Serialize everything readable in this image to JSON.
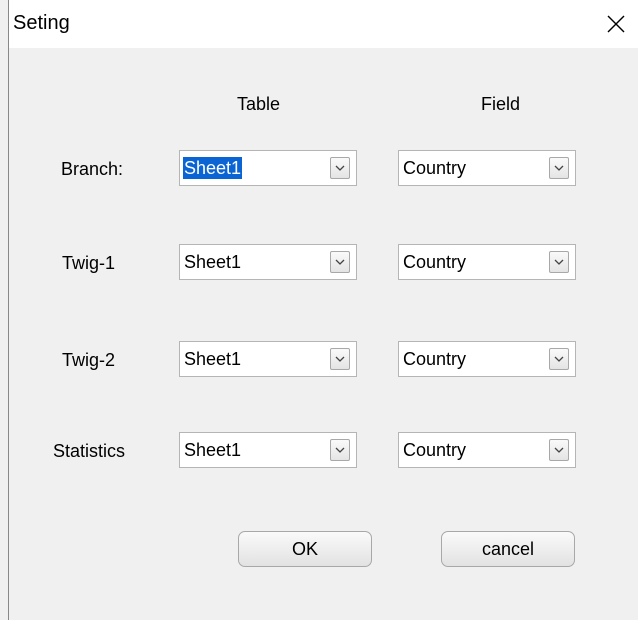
{
  "window": {
    "title": "Seting"
  },
  "columns": {
    "table": "Table",
    "field": "Field"
  },
  "rows": [
    {
      "label": "Branch:",
      "table": "Sheet1",
      "field": "Country"
    },
    {
      "label": "Twig-1",
      "table": "Sheet1",
      "field": "Country"
    },
    {
      "label": "Twig-2",
      "table": "Sheet1",
      "field": "Country"
    },
    {
      "label": "Statistics",
      "table": "Sheet1",
      "field": "Country"
    }
  ],
  "buttons": {
    "ok": "OK",
    "cancel": "cancel"
  },
  "colors": {
    "selection": "#0a64d4",
    "background": "#f0f0f0"
  }
}
